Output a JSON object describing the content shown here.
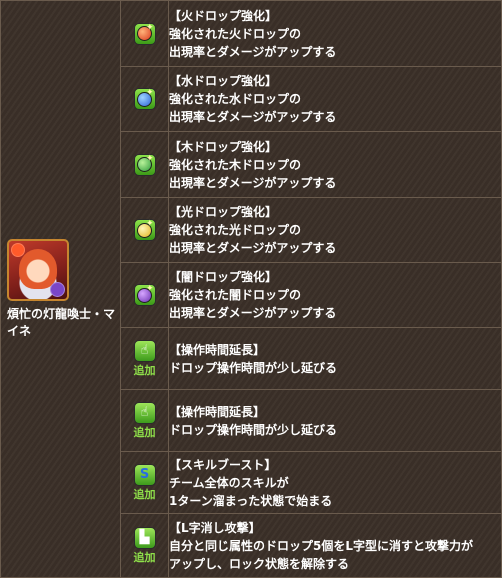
{
  "monster": {
    "name": "煩忙の灯龍喚士・マイネ"
  },
  "skills": [
    {
      "icon": "fire-orb-enhance-icon",
      "title": "【火ドロップ強化】",
      "lines": [
        "強化された火ドロップの",
        "出現率とダメージがアップする"
      ]
    },
    {
      "icon": "water-orb-enhance-icon",
      "title": "【水ドロップ強化】",
      "lines": [
        "強化された水ドロップの",
        "出現率とダメージがアップする"
      ]
    },
    {
      "icon": "wood-orb-enhance-icon",
      "title": "【木ドロップ強化】",
      "lines": [
        "強化された木ドロップの",
        "出現率とダメージがアップする"
      ]
    },
    {
      "icon": "light-orb-enhance-icon",
      "title": "【光ドロップ強化】",
      "lines": [
        "強化された光ドロップの",
        "出現率とダメージがアップする"
      ]
    },
    {
      "icon": "dark-orb-enhance-icon",
      "title": "【闇ドロップ強化】",
      "lines": [
        "強化された闇ドロップの",
        "出現率とダメージがアップする"
      ]
    },
    {
      "icon": "extend-time-icon",
      "added": "追加",
      "title": "【操作時間延長】",
      "lines": [
        "ドロップ操作時間が少し延びる"
      ]
    },
    {
      "icon": "extend-time-icon",
      "added": "追加",
      "title": "【操作時間延長】",
      "lines": [
        "ドロップ操作時間が少し延びる"
      ]
    },
    {
      "icon": "skill-boost-icon",
      "added": "追加",
      "title": "【スキルブースト】",
      "lines": [
        "チーム全体のスキルが",
        "1ターン溜まった状態で始まる"
      ]
    },
    {
      "icon": "l-shape-attack-icon",
      "added": "追加",
      "title": "【L字消し攻撃】",
      "lines": [
        "自分と同じ属性のドロップ5個をL字型に消すと攻撃力が",
        "アップし、ロック状態を解除する"
      ]
    }
  ]
}
